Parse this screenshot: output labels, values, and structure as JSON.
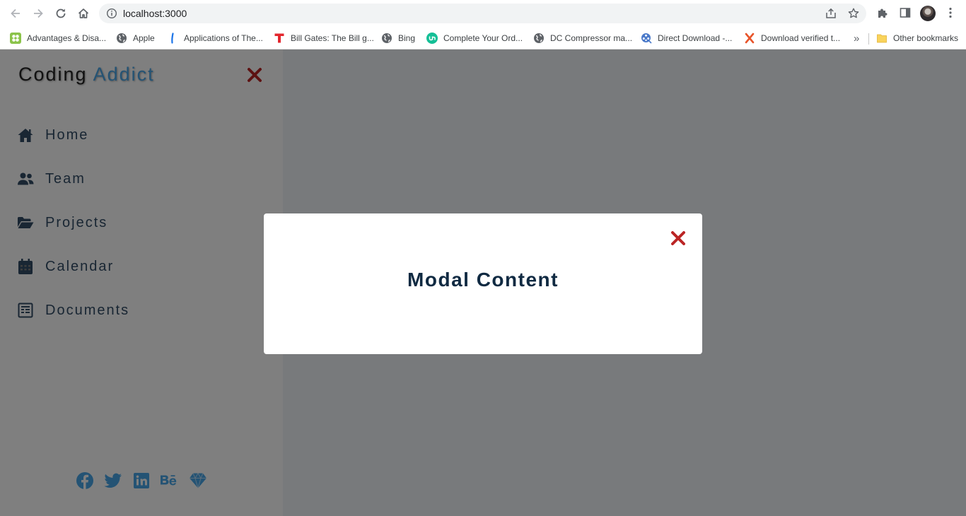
{
  "browser": {
    "url": "localhost:3000",
    "bookmarks": [
      {
        "label": "Advantages & Disa...",
        "icon": "green-flower-icon"
      },
      {
        "label": "Apple",
        "icon": "globe-icon"
      },
      {
        "label": "Applications of The...",
        "icon": "blue-l-icon"
      },
      {
        "label": "Bill Gates: The Bill g...",
        "icon": "red-t-icon"
      },
      {
        "label": "Bing",
        "icon": "globe-icon"
      },
      {
        "label": "Complete Your Ord...",
        "icon": "teal-circle-icon"
      },
      {
        "label": "DC Compressor ma...",
        "icon": "globe-icon"
      },
      {
        "label": "Direct Download -...",
        "icon": "film-reel-icon"
      },
      {
        "label": "Download verified t...",
        "icon": "red-x-icon"
      }
    ],
    "overflow": "»",
    "other_bookmarks": "Other bookmarks"
  },
  "sidebar": {
    "logo_primary": "Coding",
    "logo_accent": "Addict",
    "links": [
      {
        "label": "Home",
        "icon": "home-icon"
      },
      {
        "label": "Team",
        "icon": "users-icon"
      },
      {
        "label": "Projects",
        "icon": "folder-open-icon"
      },
      {
        "label": "Calendar",
        "icon": "calendar-icon"
      },
      {
        "label": "Documents",
        "icon": "document-icon"
      }
    ],
    "social_icons": [
      "facebook-icon",
      "twitter-icon",
      "linkedin-icon",
      "behance-icon",
      "sketch-icon"
    ]
  },
  "modal": {
    "title": "Modal Content"
  },
  "colors": {
    "accent": "#49a6e9",
    "nav_text": "#324d67",
    "close_red": "#bb2525",
    "modal_title": "#102a42",
    "page_bg": "#f1f5f8"
  }
}
